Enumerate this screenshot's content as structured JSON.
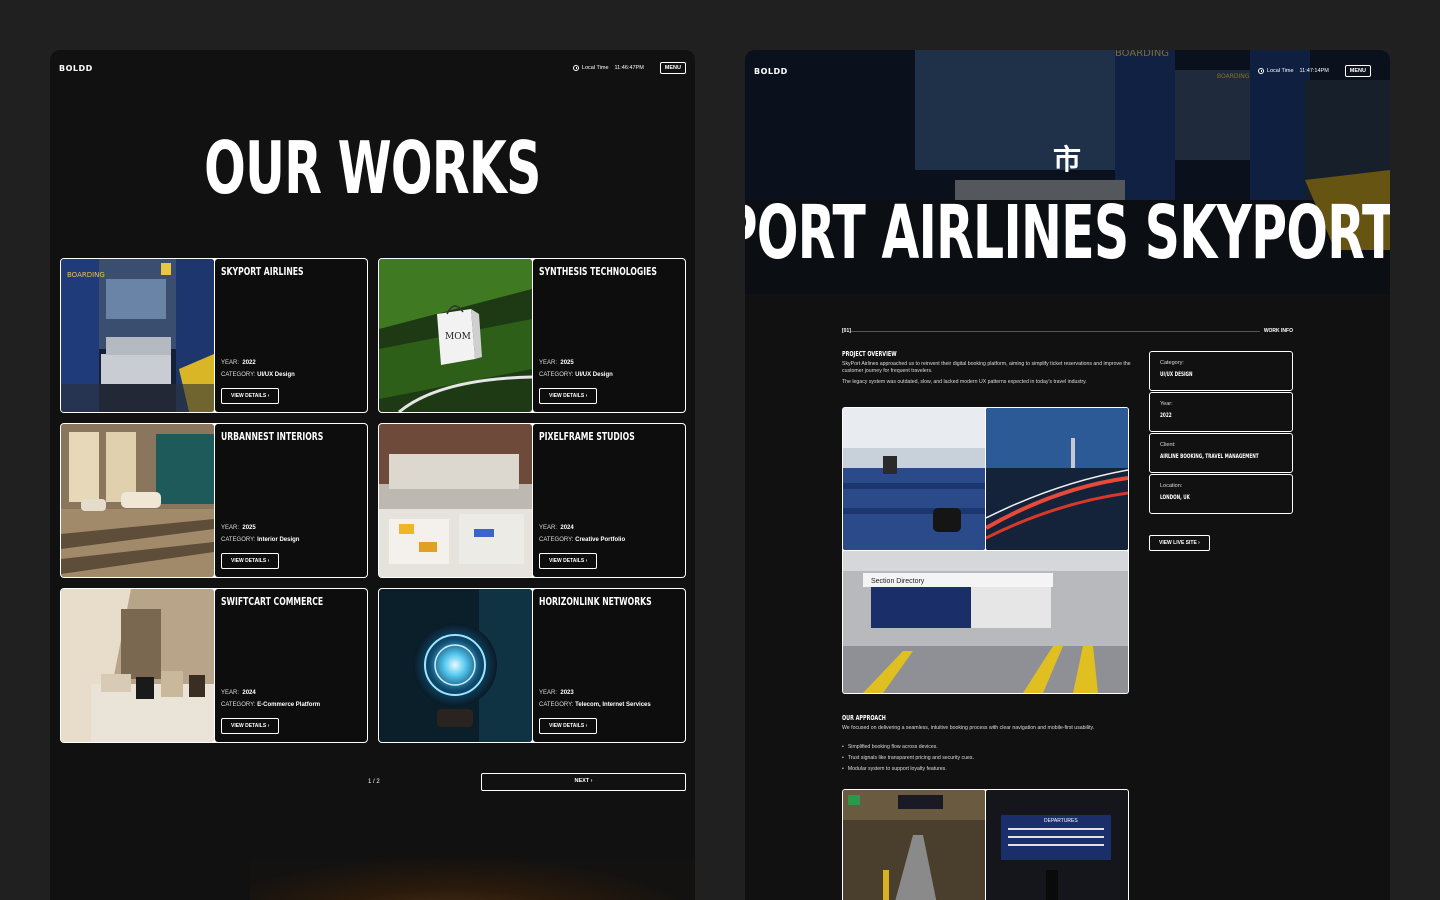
{
  "left": {
    "logo": "BOLDD",
    "local_time_label": "Local Time",
    "time": "11:46:47PM",
    "menu": "MENU",
    "title": "OUR WORKS",
    "year_label": "YEAR:",
    "category_label": "CATEGORY:",
    "view_details": "VIEW DETAILS ›",
    "projects": [
      {
        "name": "SKYPORT AIRLINES",
        "year": "2022",
        "category": "UI/UX Design"
      },
      {
        "name": "SYNTHESIS TECHNOLOGIES",
        "year": "2025",
        "category": "UI/UX Design"
      },
      {
        "name": "URBANNEST INTERIORS",
        "year": "2025",
        "category": "Interior Design"
      },
      {
        "name": "PIXELFRAME STUDIOS",
        "year": "2024",
        "category": "Creative Portfolio"
      },
      {
        "name": "SWIFTCART COMMERCE",
        "year": "2024",
        "category": "E-Commerce Platform"
      },
      {
        "name": "HORIZONLINK NETWORKS",
        "year": "2023",
        "category": "Telecom, Internet Services"
      }
    ],
    "page_indicator": "1 / 2",
    "next": "NEXT ›"
  },
  "right": {
    "logo": "BOLDD",
    "local_time_label": "Local Time",
    "time": "11:47:14PM",
    "menu": "MENU",
    "hero_glyph": "市",
    "hero_text": "YPORT AIRLINES SKYPORT A",
    "section_num": "[01]",
    "section_label": "WORK INFO",
    "overview_heading": "PROJECT OVERVIEW",
    "overview_p1": "SkyPort Airlines approached us to reinvent their digital booking platform, aiming to simplify ticket reservations and improve the customer journey for frequent travelers.",
    "overview_p2": "The legacy system was outdated, slow, and lacked modern UX patterns expected in today's travel industry.",
    "info": [
      {
        "label": "Category:",
        "value": "UI/UX DESIGN"
      },
      {
        "label": "Year:",
        "value": "2022"
      },
      {
        "label": "Client:",
        "value": "AIRLINE BOOKING, TRAVEL MANAGEMENT"
      },
      {
        "label": "Location:",
        "value": "LONDON, UK"
      }
    ],
    "live_site": "VIEW LIVE SITE ›",
    "directory_sign": "Section Directory",
    "approach_heading": "OUR APPROACH",
    "approach_p": "We focused on delivering a seamless, intuitive booking process with clear navigation and mobile-first usability.",
    "bullets": [
      "Simplified booking flow across devices.",
      "Trust signals like transparent pricing and security cues.",
      "Modular system to support loyalty features."
    ],
    "departures_sign": "DEPARTURES"
  }
}
